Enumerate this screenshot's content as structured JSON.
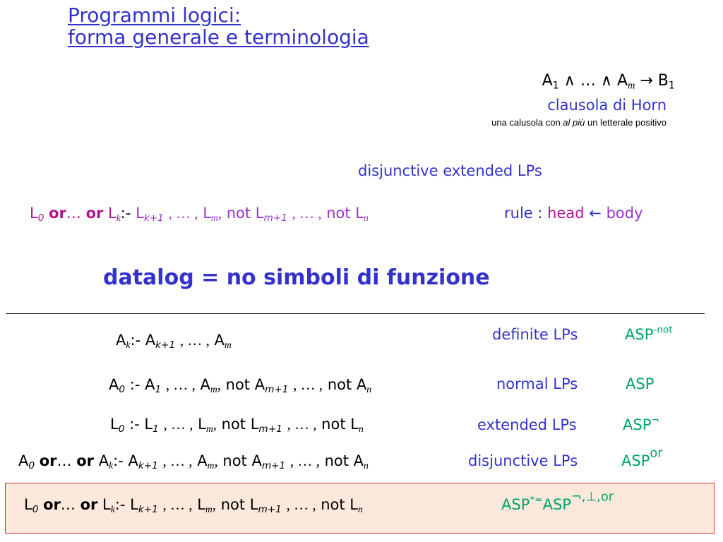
{
  "title": {
    "line1": "Programmi logici:",
    "line2": "forma generale e terminologia"
  },
  "horn": {
    "formula": "A1 ∧ … ∧ Am → B1",
    "label": "clausola di Horn",
    "description": "una calusola con al più un letterale positivo"
  },
  "disjunctive_extended_label": "disjunctive extended LPs",
  "general_rule": "L0 or… or Lk:- Lk+1 , … , Lm , not Lm+1 , … , not Ln",
  "rule_legend": {
    "prefix": "rule :",
    "head": "head",
    "arrow": "←",
    "body": "body"
  },
  "datalog": "datalog = no simboli di funzione",
  "rows": [
    {
      "formula": "Ak:- Ak+1 , … , Am",
      "name": "definite LPs",
      "class": "ASP-not"
    },
    {
      "formula": "A0 :- A1 , … , Am , not Am+1 , … , not An",
      "name": "normal LPs",
      "class": "ASP"
    },
    {
      "formula": "L0 :- L1 , … , Lm , not Lm+1 , … , not Ln",
      "name": "extended LPs",
      "class": "ASP¬"
    },
    {
      "formula": "A0 or… or Ak:- Ak+1 , … , Am , not Am+1 , … , not An",
      "name": "disjunctive LPs",
      "class": "ASPor"
    },
    {
      "formula": "L0 or… or Lk:- Lk+1 , … , Lm , not Lm+1 , … , not Ln",
      "name": "",
      "class": "ASP*=ASP¬,⊥,or"
    }
  ]
}
